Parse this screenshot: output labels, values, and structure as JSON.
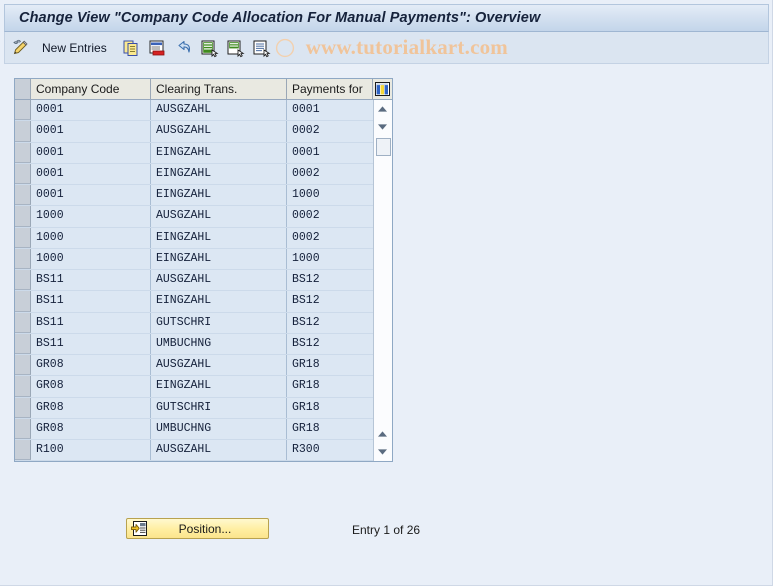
{
  "window": {
    "title": "Change View \"Company Code Allocation For Manual Payments\": Overview"
  },
  "toolbar": {
    "display_change_icon": "pencil-display-change-icon",
    "new_entries_label": "New Entries",
    "icons": [
      {
        "name": "copy-icon",
        "title": "Copy As..."
      },
      {
        "name": "delete-icon",
        "title": "Delete"
      },
      {
        "name": "undo-icon",
        "title": "Undo Change"
      },
      {
        "name": "select-all-icon",
        "title": "Select All"
      },
      {
        "name": "select-block-icon",
        "title": "Select Block"
      },
      {
        "name": "deselect-all-icon",
        "title": "Deselect All"
      }
    ],
    "watermark": "www.tutorialkart.com"
  },
  "table": {
    "config_icon": "table-settings-icon",
    "columns": [
      "Company Code",
      "Clearing Trans.",
      "Payments for"
    ],
    "rows": [
      [
        "0001",
        "AUSGZAHL",
        "0001"
      ],
      [
        "0001",
        "AUSGZAHL",
        "0002"
      ],
      [
        "0001",
        "EINGZAHL",
        "0001"
      ],
      [
        "0001",
        "EINGZAHL",
        "0002"
      ],
      [
        "0001",
        "EINGZAHL",
        "1000"
      ],
      [
        "1000",
        "AUSGZAHL",
        "0002"
      ],
      [
        "1000",
        "EINGZAHL",
        "0002"
      ],
      [
        "1000",
        "EINGZAHL",
        "1000"
      ],
      [
        "BS11",
        "AUSGZAHL",
        "BS12"
      ],
      [
        "BS11",
        "EINGZAHL",
        "BS12"
      ],
      [
        "BS11",
        "GUTSCHRI",
        "BS12"
      ],
      [
        "BS11",
        "UMBUCHNG",
        "BS12"
      ],
      [
        "GR08",
        "AUSGZAHL",
        "GR18"
      ],
      [
        "GR08",
        "EINGZAHL",
        "GR18"
      ],
      [
        "GR08",
        "GUTSCHRI",
        "GR18"
      ],
      [
        "GR08",
        "UMBUCHNG",
        "GR18"
      ],
      [
        "R100",
        "AUSGZAHL",
        "R300"
      ]
    ]
  },
  "scrollbar": {
    "up_arrow": "scroll-up-icon",
    "down_arrow": "scroll-down-icon",
    "thumb": "scroll-thumb"
  },
  "footer": {
    "position_label": "Position...",
    "position_icon": "position-goto-icon",
    "entry_status": "Entry 1 of 26"
  },
  "colors": {
    "background": "#e9eff8",
    "title_bar": "#d3e0f0",
    "toolbar": "#dbe5f1",
    "table_header": "#e9e9e1",
    "table_row": "#dce7f3",
    "row_selector": "#c8cfd8",
    "button_yellow": "#ffeea1",
    "watermark": "#f0c49a",
    "text": "#14203a"
  }
}
